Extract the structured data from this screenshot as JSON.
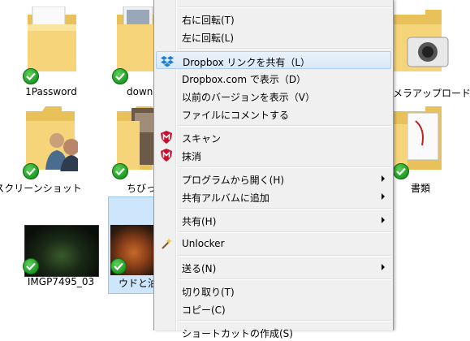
{
  "items": [
    {
      "label": "1Password"
    },
    {
      "label": "down"
    },
    {
      "label": "スクリーンショット"
    },
    {
      "label": "ちびっ子"
    },
    {
      "label": "IMGP7495_03"
    },
    {
      "label": "ウドと油麩"
    },
    {
      "label": "カメラアップロード"
    },
    {
      "label": "書類"
    }
  ],
  "menu": {
    "items": [
      {
        "label": "右に回転(T)"
      },
      {
        "label": "左に回転(L)"
      },
      {
        "label": "Dropbox リンクを共有（L）"
      },
      {
        "label": "Dropbox.com で表示（D）"
      },
      {
        "label": "以前のバージョンを表示（V）"
      },
      {
        "label": "ファイルにコメントする"
      },
      {
        "label": "スキャン"
      },
      {
        "label": "抹消"
      },
      {
        "label": "プログラムから開く(H)"
      },
      {
        "label": "共有アルバムに追加"
      },
      {
        "label": "共有(H)"
      },
      {
        "label": "Unlocker"
      },
      {
        "label": "送る(N)"
      },
      {
        "label": "切り取り(T)"
      },
      {
        "label": "コピー(C)"
      },
      {
        "label": "ショートカットの作成(S)"
      }
    ]
  },
  "icons": {
    "dropbox": "dropbox-icon",
    "mcafee": "mcafee-icon",
    "unlocker": "wand-icon",
    "check": "sync-check-icon"
  },
  "colors": {
    "highlight": "#d9e8f7",
    "menu_bg": "#f0f0f0",
    "check_green": "#1d9a23"
  }
}
